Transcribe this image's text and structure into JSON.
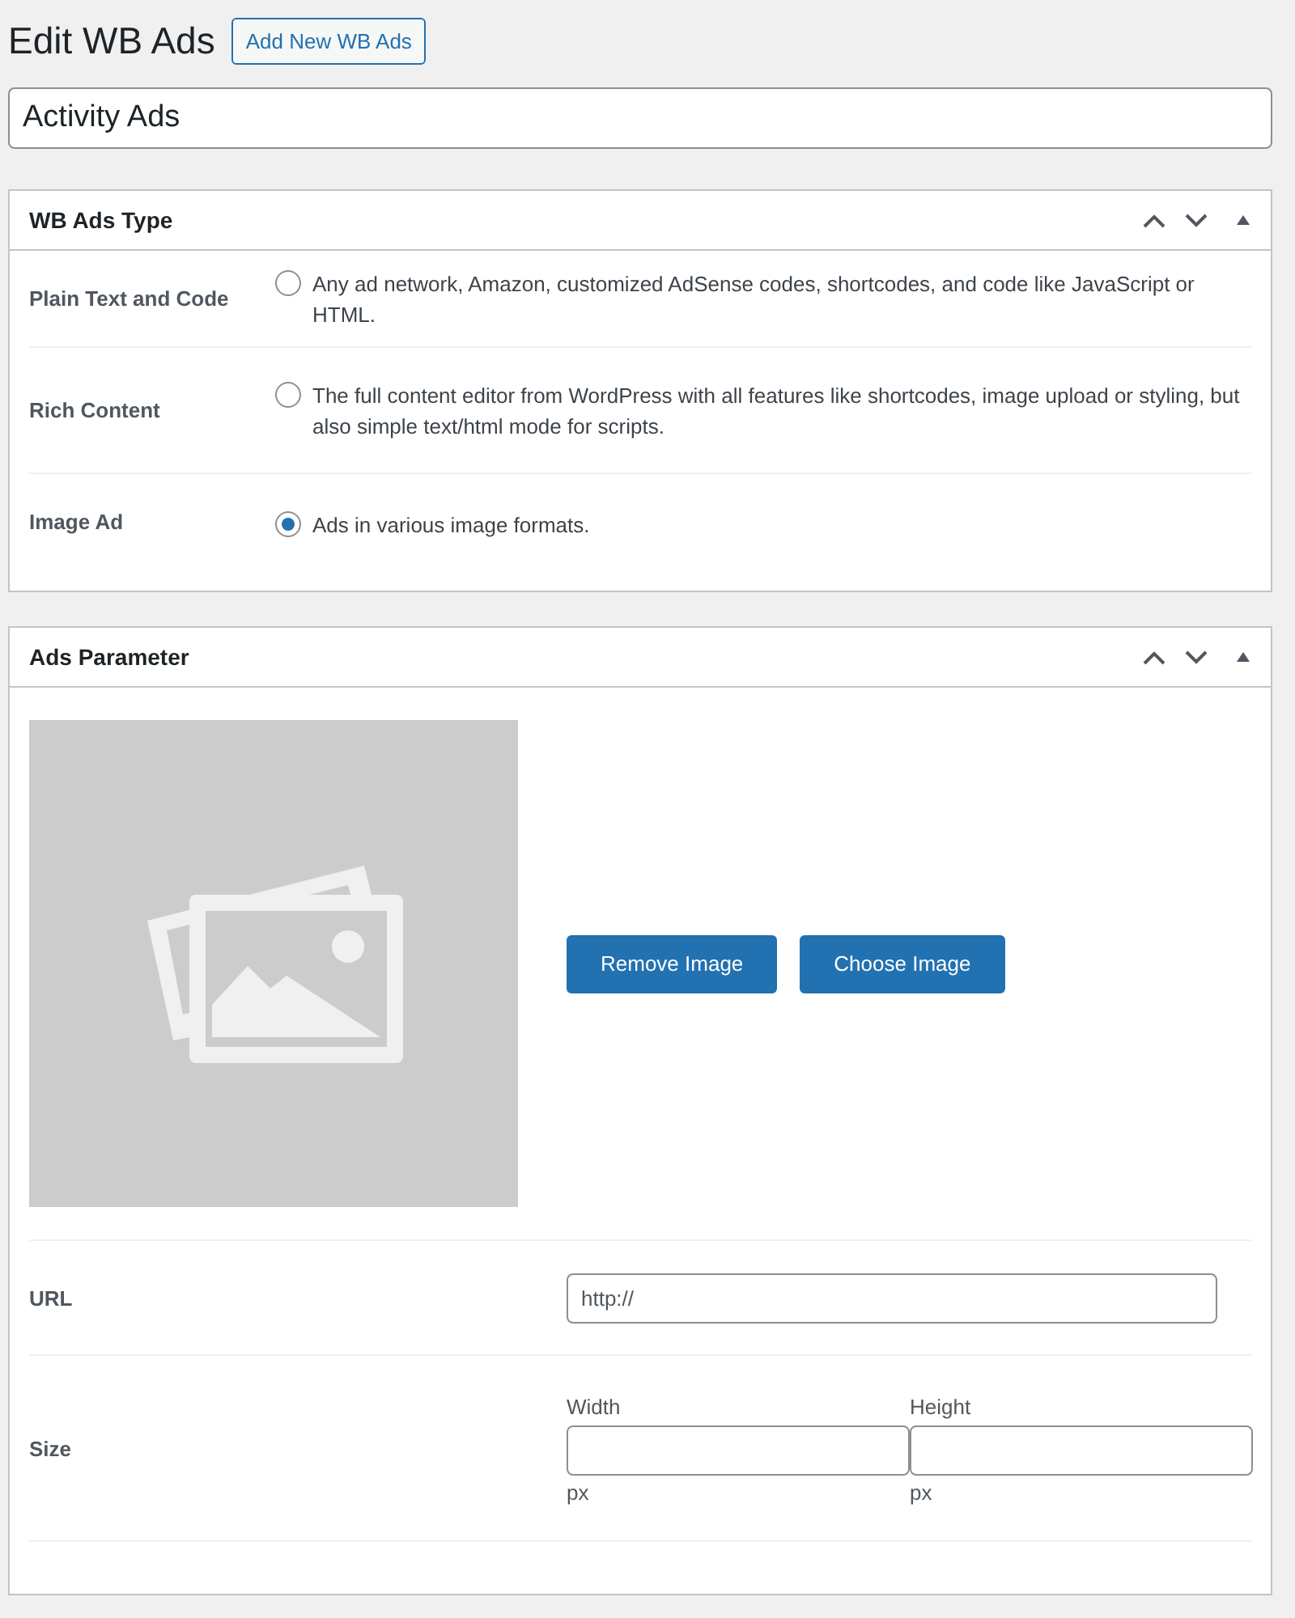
{
  "page_title": "Edit WB Ads",
  "add_button": "Add New WB Ads",
  "title_field": {
    "value": "Activity Ads"
  },
  "type_panel": {
    "title": "WB Ads Type",
    "options": [
      {
        "label": "Plain Text and Code",
        "description": "Any ad network, Amazon, customized AdSense codes, shortcodes, and code like JavaScript or HTML.",
        "selected": false
      },
      {
        "label": "Rich Content",
        "description": "The full content editor from WordPress with all features like shortcodes, image upload or styling, but also simple text/html mode for scripts.",
        "selected": false
      },
      {
        "label": "Image Ad",
        "description": "Ads in various image formats.",
        "selected": true
      }
    ]
  },
  "params_panel": {
    "title": "Ads Parameter",
    "image_buttons": [
      "Remove Image",
      "Choose Image"
    ],
    "url": {
      "label": "URL",
      "placeholder": "http://"
    },
    "size": {
      "label": "Size",
      "fields": [
        {
          "label": "Width",
          "unit": "px"
        },
        {
          "label": "Height",
          "unit": "px"
        }
      ]
    }
  }
}
